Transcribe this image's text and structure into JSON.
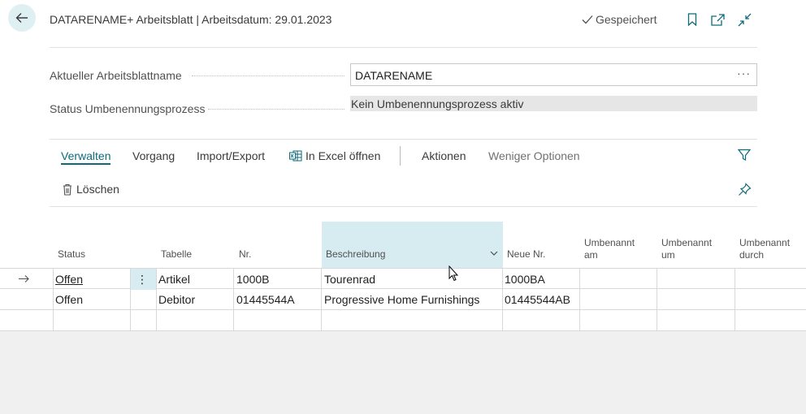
{
  "header": {
    "title": "DATARENAME+ Arbeitsblatt | Arbeitsdatum: 29.01.2023",
    "saved_label": "Gespeichert",
    "icons": [
      "back-arrow-icon",
      "bookmark-icon",
      "open-new-window-icon",
      "collapse-icon"
    ]
  },
  "fields": {
    "current_sheet_label": "Aktueller Arbeitsblattname",
    "current_sheet_value": "DATARENAME",
    "current_sheet_more": "···",
    "status_label": "Status Umbenennungsprozess",
    "status_value": "Kein Umbenennungsprozess aktiv"
  },
  "menu": {
    "items": [
      "Verwalten",
      "Vorgang",
      "Import/Export",
      "In Excel öffnen",
      "Aktionen",
      "Weniger Optionen"
    ],
    "delete_label": "Löschen"
  },
  "grid": {
    "columns": [
      "Status",
      "Tabelle",
      "Nr.",
      "Beschreibung",
      "Neue Nr.",
      "Umbenannt am",
      "Umbenannt um",
      "Umbenannt durch"
    ],
    "col_umb_am": [
      "Umbenannt",
      "am"
    ],
    "col_umb_um": [
      "Umbenannt",
      "um"
    ],
    "col_umb_durch": [
      "Umbenannt",
      "durch"
    ],
    "rows": [
      {
        "status": "Offen",
        "tabelle": "Artikel",
        "nr": "1000B",
        "beschreibung": "Tourenrad",
        "neue_nr": "1000BA",
        "am": "",
        "um": "",
        "durch": ""
      },
      {
        "status": "Offen",
        "tabelle": "Debitor",
        "nr": "01445544A",
        "beschreibung": "Progressive Home Furnishings",
        "neue_nr": "01445544AB",
        "am": "",
        "um": "",
        "durch": ""
      }
    ]
  },
  "colors": {
    "accent": "#0e6a79",
    "selected_header": "#d6ecf0",
    "back_button_bg": "#dff0f3"
  }
}
